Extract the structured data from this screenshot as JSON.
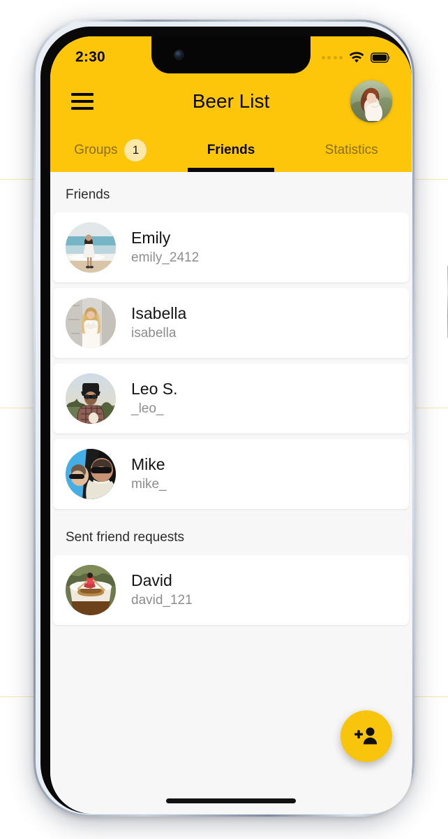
{
  "colors": {
    "brand_yellow": "#FDC60B",
    "fab_yellow": "#F9C40C",
    "badge_bg": "#FCE8A8",
    "tab_inactive": "#8A6F0C",
    "content_bg": "#F7F7F7",
    "card_bg": "#FFFFFF",
    "name_text": "#141414",
    "handle_text": "#8D8D8D"
  },
  "status_bar": {
    "time": "2:30",
    "cellular_icon": "signal-dots-icon",
    "wifi_icon": "wifi-icon",
    "battery_icon": "battery-full-icon"
  },
  "nav": {
    "menu_icon": "hamburger-menu-icon",
    "title": "Beer List",
    "avatar_icon": "user-profile-avatar"
  },
  "tabs": [
    {
      "label": "Groups",
      "active": false,
      "badge": "1"
    },
    {
      "label": "Friends",
      "active": true,
      "badge": null
    },
    {
      "label": "Statistics",
      "active": false,
      "badge": null
    }
  ],
  "sections": [
    {
      "header": "Friends",
      "rows": [
        {
          "name": "Emily",
          "handle": "emily_2412",
          "avatar": "avatar-beach-woman"
        },
        {
          "name": "Isabella",
          "handle": "isabella",
          "avatar": "avatar-blonde-woman"
        },
        {
          "name": "Leo S.",
          "handle": "_leo_",
          "avatar": "avatar-man-hat"
        },
        {
          "name": "Mike",
          "handle": "mike_",
          "avatar": "avatar-man-sunglasses"
        }
      ]
    },
    {
      "header": "Sent friend requests",
      "rows": [
        {
          "name": "David",
          "handle": "david_121",
          "avatar": "avatar-beer-rower"
        }
      ]
    }
  ],
  "fab": {
    "icon": "person-add-icon",
    "label": "Add friend"
  },
  "system": {
    "home_indicator": "home-indicator-bar"
  }
}
